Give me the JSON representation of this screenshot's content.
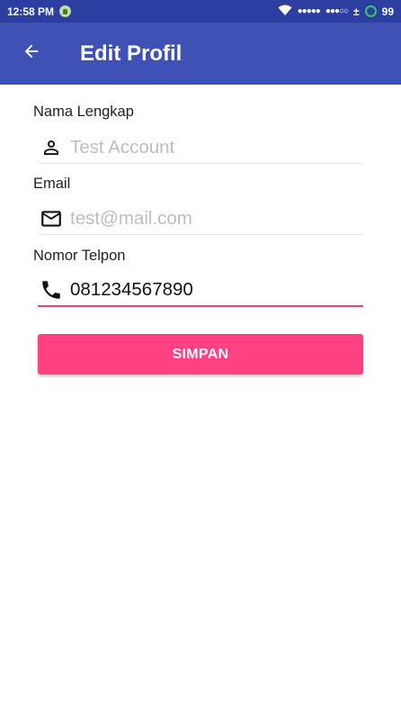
{
  "status_bar": {
    "time": "12:58 PM",
    "signal_1": "●●●●●",
    "signal_2": "●●●○○",
    "plus_minus": "±",
    "battery": "99"
  },
  "app_bar": {
    "title": "Edit Profil",
    "back_icon": "arrow-back-icon"
  },
  "form": {
    "name": {
      "label": "Nama Lengkap",
      "placeholder": "Test Account",
      "value": "",
      "icon": "person-icon"
    },
    "email": {
      "label": "Email",
      "placeholder": "test@mail.com",
      "value": "",
      "icon": "mail-icon"
    },
    "phone": {
      "label": "Nomor Telpon",
      "placeholder": "",
      "value": "081234567890",
      "icon": "phone-icon"
    },
    "submit_label": "SIMPAN"
  },
  "colors": {
    "app_bar": "#3f51b5",
    "status_bar": "#2c3e9f",
    "accent": "#ff4081",
    "focused_underline": "#e0457b"
  }
}
